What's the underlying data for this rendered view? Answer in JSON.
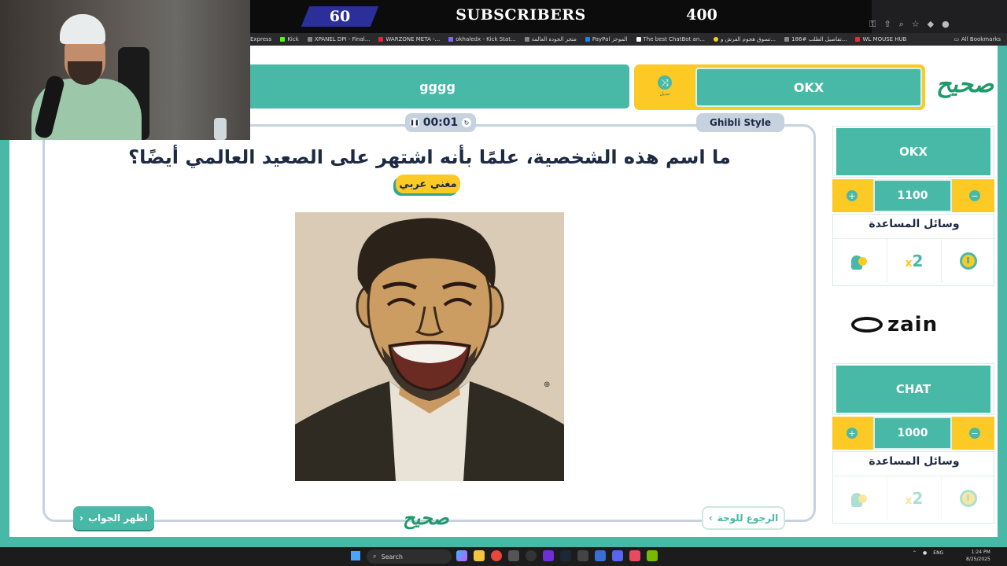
{
  "stream_overlay": {
    "count_left": "60",
    "title": "SUBSCRIBERS",
    "count_right": "400"
  },
  "bookmarks": {
    "items": [
      "Express",
      "Kick",
      "XPANEL DPI - Final...",
      "WARZONE META -...",
      "okhaledx - Kick Stat...",
      "متجر الجودة العالمة",
      "PayPal الموجز",
      "The best ChatBot an...",
      "تسوق هجوم الفرش و...",
      "تفاصيل الطلب #186...",
      "WL MOUSE HUB"
    ],
    "all_label": "All Bookmarks"
  },
  "header": {
    "team_left_label": "gggg",
    "current_team_label": "OKX",
    "swap_label": "تبديل",
    "logo_text": "صحيح"
  },
  "board": {
    "timer": "00:01",
    "category": "Ghibli Style",
    "question": "ما اسم هذه الشخصية، علمًا بأنه اشتهر على الصعيد العالمي أيضًا؟",
    "hint": "مغني عربي",
    "show_answer_label": "اظهر الجواب",
    "back_label": "الرجوع للوحة",
    "footer_logo_text": "صحيح"
  },
  "teams": [
    {
      "name": "OKX",
      "score": "1100",
      "aids_title": "وسائل المساعدة",
      "aids_used": false
    },
    {
      "name": "CHAT",
      "score": "1000",
      "aids_title": "وسائل المساعدة",
      "aids_used": true
    }
  ],
  "sponsor": {
    "name": "zain"
  },
  "taskbar": {
    "search_placeholder": "Search",
    "lang": "ENG",
    "time": "1:24 PM",
    "date": "8/25/2025"
  },
  "icons": {
    "plus": "plus-icon",
    "minus": "minus-icon",
    "swap": "swap-icon",
    "pause": "pause-icon",
    "reset": "reset-icon",
    "aid_call": "call-friend-icon",
    "aid_double": "double-points-icon",
    "aid_time": "extra-time-icon"
  },
  "colors": {
    "teal": "#48b9a6",
    "yellow": "#fcc925",
    "navy": "#1d2a44",
    "timer_bg": "#c6d2df"
  }
}
